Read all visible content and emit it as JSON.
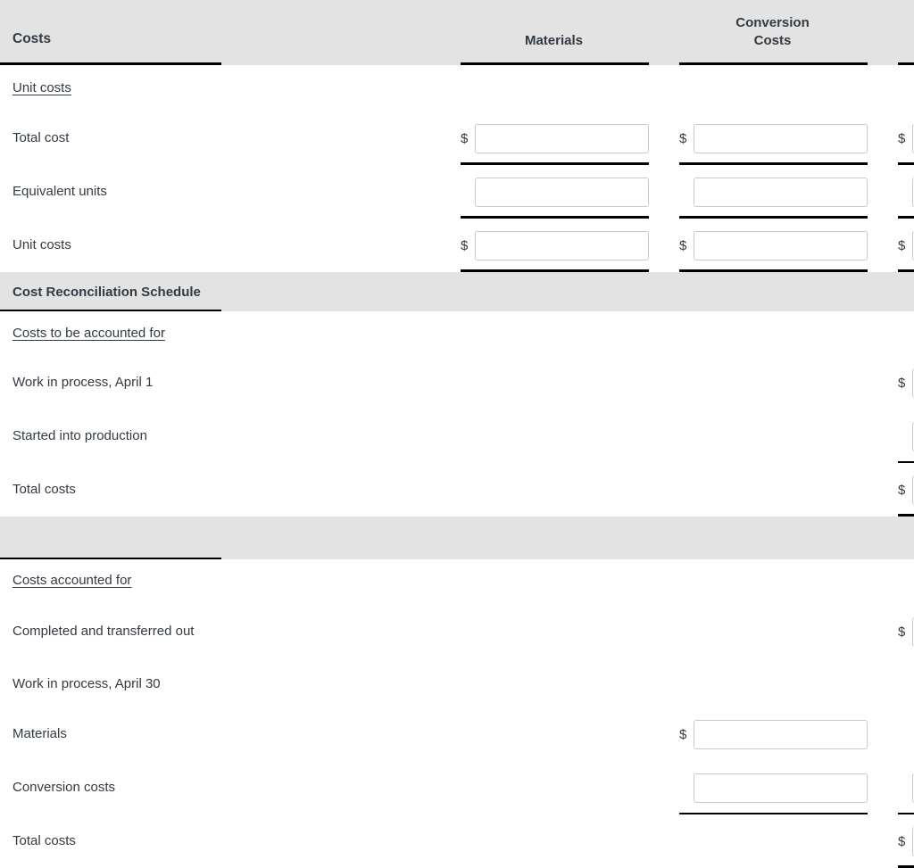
{
  "table": {
    "columns": [
      {
        "key": "label",
        "label": "Costs"
      },
      {
        "key": "materials",
        "label": "Materials"
      },
      {
        "key": "conversion",
        "label": "Conversion\nCosts"
      },
      {
        "key": "total",
        "label": ""
      }
    ],
    "header": {
      "label_col": "Costs",
      "materials": "Materials",
      "conversion_line1": "Conversion",
      "conversion_line2": "Costs",
      "total": ""
    },
    "sections": [
      {
        "id": "unit-costs-section",
        "title": ""
      },
      {
        "id": "cost-reconciliation",
        "title": "Cost Reconciliation Schedule"
      },
      {
        "id": "costs-accounted-section",
        "title": ""
      }
    ],
    "rows": [
      {
        "id": "unit-costs-heading",
        "label": "Unit costs",
        "indent": 0,
        "underlined": true,
        "fields": []
      },
      {
        "id": "total-cost",
        "label": "Total cost",
        "indent": 1,
        "underlined": false,
        "fields": [
          "materials",
          "conversion",
          "total"
        ]
      },
      {
        "id": "equivalent-units",
        "label": "Equivalent units",
        "indent": 1,
        "underlined": false,
        "fields": [
          "materials",
          "conversion",
          "total"
        ]
      },
      {
        "id": "unit-costs-value",
        "label": "Unit costs",
        "indent": 1,
        "underlined": false,
        "fields": [
          "materials",
          "conversion",
          "total"
        ]
      },
      {
        "id": "costs-to-be-accounted-for",
        "label": "Costs to be accounted for",
        "indent": 0,
        "underlined": true,
        "fields": []
      },
      {
        "id": "wip-april-1",
        "label": "Work in process, April 1",
        "indent": 1,
        "underlined": false,
        "fields": [
          "total"
        ]
      },
      {
        "id": "started-into-production",
        "label": "Started into production",
        "indent": 1,
        "underlined": false,
        "fields": [
          "total"
        ]
      },
      {
        "id": "total-costs-upper",
        "label": "Total costs",
        "indent": 0,
        "underlined": false,
        "fields": [
          "total"
        ]
      },
      {
        "id": "costs-accounted-for",
        "label": "Costs accounted for",
        "indent": 0,
        "underlined": true,
        "fields": []
      },
      {
        "id": "completed-transferred-out",
        "label": "Completed and transferred out",
        "indent": 1,
        "underlined": false,
        "fields": [
          "total"
        ]
      },
      {
        "id": "wip-april-30",
        "label": "Work in process, April 30",
        "indent": 1,
        "underlined": false,
        "fields": []
      },
      {
        "id": "wip-materials",
        "label": "Materials",
        "indent": 2,
        "underlined": false,
        "fields": [
          "conversion"
        ]
      },
      {
        "id": "wip-conversion-costs",
        "label": "Conversion costs",
        "indent": 2,
        "underlined": false,
        "fields": [
          "conversion",
          "total"
        ]
      },
      {
        "id": "total-costs-lower",
        "label": "Total costs",
        "indent": 1,
        "underlined": false,
        "fields": [
          "total"
        ]
      }
    ],
    "currency_symbol": "$",
    "input_value": "",
    "input_placeholder": ""
  },
  "colors": {
    "header_background": "#e3e3e3",
    "text": "#333a42",
    "rule": "#000000",
    "input_border": "#c9cacb",
    "page_background": "#ffffff"
  }
}
